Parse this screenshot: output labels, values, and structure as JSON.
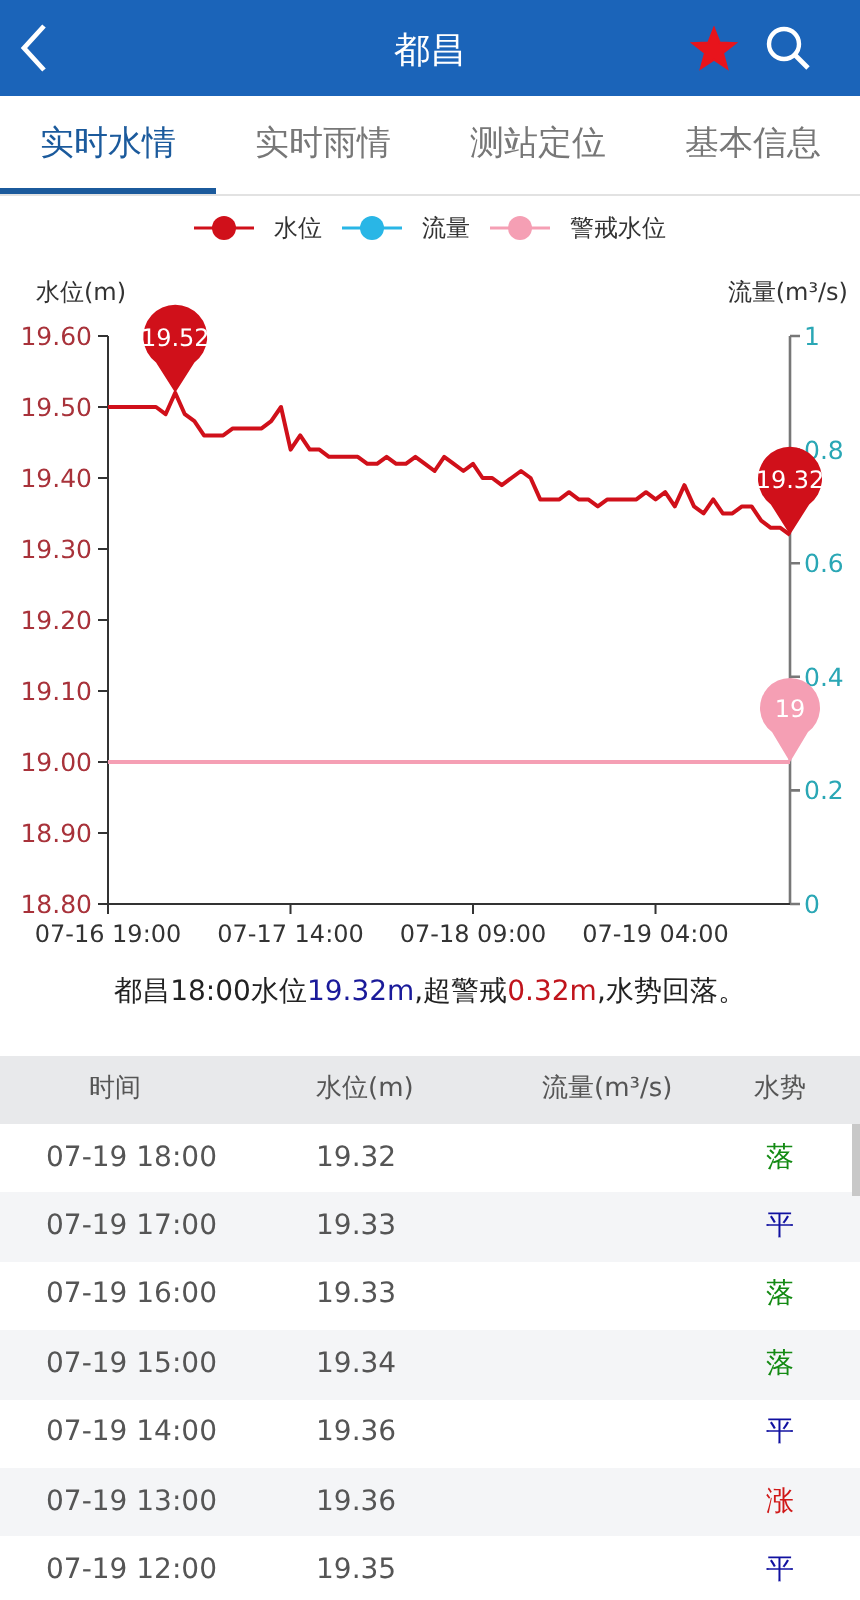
{
  "header": {
    "title": "都昌",
    "favorite": true
  },
  "tabs": [
    {
      "label": "实时水情",
      "selected": true
    },
    {
      "label": "实时雨情",
      "selected": false
    },
    {
      "label": "测站定位",
      "selected": false
    },
    {
      "label": "基本信息",
      "selected": false
    }
  ],
  "chart_data": {
    "type": "line",
    "ylabel": "水位(m)",
    "y2label": "流量(m³/s)",
    "categories": [
      "07-16 19:00",
      null,
      null,
      null,
      null,
      null,
      null,
      null,
      null,
      null,
      null,
      null,
      null,
      null,
      null,
      null,
      null,
      null,
      null,
      "07-17 14:00",
      null,
      null,
      null,
      null,
      null,
      null,
      null,
      null,
      null,
      null,
      null,
      null,
      null,
      null,
      null,
      null,
      null,
      null,
      "07-18 09:00",
      null,
      null,
      null,
      null,
      null,
      null,
      null,
      null,
      null,
      null,
      null,
      null,
      null,
      null,
      null,
      null,
      null,
      null,
      "07-19 04:00",
      null,
      null,
      null,
      null,
      null,
      null,
      null,
      null,
      null,
      null,
      null,
      null,
      null,
      null
    ],
    "ylim": [
      18.8,
      19.6
    ],
    "yticks": [
      {
        "value": 18.8,
        "label": "18.80"
      },
      {
        "value": 18.9,
        "label": "18.90"
      },
      {
        "value": 19.0,
        "label": "19.00"
      },
      {
        "value": 19.1,
        "label": "19.10"
      },
      {
        "value": 19.2,
        "label": "19.20"
      },
      {
        "value": 19.3,
        "label": "19.30"
      },
      {
        "value": 19.4,
        "label": "19.40"
      },
      {
        "value": 19.5,
        "label": "19.50"
      },
      {
        "value": 19.6,
        "label": "19.60"
      }
    ],
    "y2lim": [
      0,
      1
    ],
    "y2ticks": [
      {
        "value": 0,
        "label": "0"
      },
      {
        "value": 0.2,
        "label": "0.2"
      },
      {
        "value": 0.4,
        "label": "0.4"
      },
      {
        "value": 0.6,
        "label": "0.6"
      },
      {
        "value": 0.8,
        "label": "0.8"
      },
      {
        "value": 1,
        "label": "1"
      }
    ],
    "series": [
      {
        "name": "水位",
        "color": "#d0101a",
        "values": [
          19.5,
          19.5,
          19.5,
          19.5,
          19.5,
          19.5,
          19.49,
          19.52,
          19.49,
          19.48,
          19.46,
          19.46,
          19.46,
          19.47,
          19.47,
          19.47,
          19.47,
          19.48,
          19.5,
          19.44,
          19.46,
          19.44,
          19.44,
          19.43,
          19.43,
          19.43,
          19.43,
          19.42,
          19.42,
          19.43,
          19.42,
          19.42,
          19.43,
          19.42,
          19.41,
          19.43,
          19.42,
          19.41,
          19.42,
          19.4,
          19.4,
          19.39,
          19.4,
          19.41,
          19.4,
          19.37,
          19.37,
          19.37,
          19.38,
          19.37,
          19.37,
          19.36,
          19.37,
          19.37,
          19.37,
          19.37,
          19.38,
          19.37,
          19.38,
          19.36,
          19.39,
          19.36,
          19.35,
          19.37,
          19.35,
          19.35,
          19.36,
          19.36,
          19.34,
          19.33,
          19.33,
          19.32
        ]
      },
      {
        "name": "流量",
        "color": "#29b6e6",
        "values": [
          null,
          null,
          null,
          null,
          null,
          null,
          null,
          null,
          null,
          null,
          null,
          null,
          null,
          null,
          null,
          null,
          null,
          null,
          null,
          null,
          null,
          null,
          null,
          null,
          null,
          null,
          null,
          null,
          null,
          null,
          null,
          null,
          null,
          null,
          null,
          null,
          null,
          null,
          null,
          null,
          null,
          null,
          null,
          null,
          null,
          null,
          null,
          null,
          null,
          null,
          null,
          null,
          null,
          null,
          null,
          null,
          null,
          null,
          null,
          null,
          null,
          null,
          null,
          null,
          null,
          null,
          null,
          null,
          null,
          null,
          null,
          null
        ]
      },
      {
        "name": "警戒水位",
        "color": "#f59fb4",
        "values": [
          19,
          19,
          19,
          19,
          19,
          19,
          19,
          19,
          19,
          19,
          19,
          19,
          19,
          19,
          19,
          19,
          19,
          19,
          19,
          19,
          19,
          19,
          19,
          19,
          19,
          19,
          19,
          19,
          19,
          19,
          19,
          19,
          19,
          19,
          19,
          19,
          19,
          19,
          19,
          19,
          19,
          19,
          19,
          19,
          19,
          19,
          19,
          19,
          19,
          19,
          19,
          19,
          19,
          19,
          19,
          19,
          19,
          19,
          19,
          19,
          19,
          19,
          19,
          19,
          19,
          19,
          19,
          19,
          19,
          19,
          19,
          19
        ]
      }
    ],
    "annotations": [
      {
        "y": 19.52,
        "text": "19.52"
      },
      {
        "y": 19.32,
        "text": "19.32"
      },
      {
        "y": 19.0,
        "text": "19"
      }
    ]
  },
  "summary": [
    {
      "kind": "plain",
      "text": "都昌18:00水位"
    },
    {
      "kind": "level",
      "text": "19.32m"
    },
    {
      "kind": "plain",
      "text": ",超警戒"
    },
    {
      "kind": "excess",
      "text": "0.32m"
    },
    {
      "kind": "plain",
      "text": ",水势回落。"
    }
  ],
  "table": {
    "columns": [
      "时间",
      "水位(m)",
      "流量(m³/s)",
      "水势"
    ],
    "rows": [
      {
        "time": "07-19 18:00",
        "level": "19.32",
        "trend": "落",
        "color": "#138a13"
      },
      {
        "time": "07-19 17:00",
        "level": "19.33",
        "trend": "平",
        "color": "#1010a0"
      },
      {
        "time": "07-19 16:00",
        "level": "19.33",
        "trend": "落",
        "color": "#138a13"
      },
      {
        "time": "07-19 15:00",
        "level": "19.34",
        "trend": "落",
        "color": "#138a13"
      },
      {
        "time": "07-19 14:00",
        "level": "19.36",
        "trend": "平",
        "color": "#1010a0"
      },
      {
        "time": "07-19 13:00",
        "level": "19.36",
        "trend": "涨",
        "color": "#d01818"
      },
      {
        "time": "07-19 12:00",
        "level": "19.35",
        "trend": "平",
        "color": "#1010a0"
      }
    ]
  }
}
